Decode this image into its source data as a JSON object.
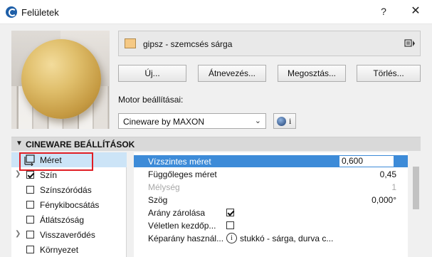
{
  "window": {
    "title": "Felületek",
    "help": "?",
    "close": "✕"
  },
  "material": {
    "name": "gipsz - szemcsés sárga",
    "swatch_color": "#f5c985"
  },
  "buttons": {
    "new": "Új...",
    "rename": "Átnevezés...",
    "share": "Megosztás...",
    "delete": "Törlés..."
  },
  "engine": {
    "label": "Motor beállításai:",
    "value": "Cineware by MAXON",
    "info": "i"
  },
  "section": {
    "title": "CINEWARE BEÁLLÍTÁSOK"
  },
  "channels": [
    {
      "label": "Méret",
      "checked": null,
      "selected": true
    },
    {
      "label": "Szín",
      "checked": true,
      "expandable": true
    },
    {
      "label": "Színszóródás",
      "checked": false
    },
    {
      "label": "Fénykibocsátás",
      "checked": false
    },
    {
      "label": "Átlátszóság",
      "checked": false
    },
    {
      "label": "Visszaverődés",
      "checked": false,
      "expandable": true
    },
    {
      "label": "Környezet",
      "checked": false
    }
  ],
  "properties": [
    {
      "label": "Vízszintes méret",
      "input_value": "0,600",
      "selected": true
    },
    {
      "label": "Függőleges méret",
      "value": "0,45"
    },
    {
      "label": "Mélység",
      "value": "1",
      "disabled": true
    },
    {
      "label": "Szög",
      "value": "0,000°"
    },
    {
      "label": "Arány zárolása",
      "checkbox": true
    },
    {
      "label": "Véletlen kezdőp...",
      "checkbox": false
    },
    {
      "label": "Képarány használ...",
      "info": "i",
      "link": "stukkó - sárga, durva c..."
    }
  ],
  "colors": {
    "accent": "#3d8bd8",
    "selection": "#cce4f7",
    "highlight": "#e01e25"
  }
}
